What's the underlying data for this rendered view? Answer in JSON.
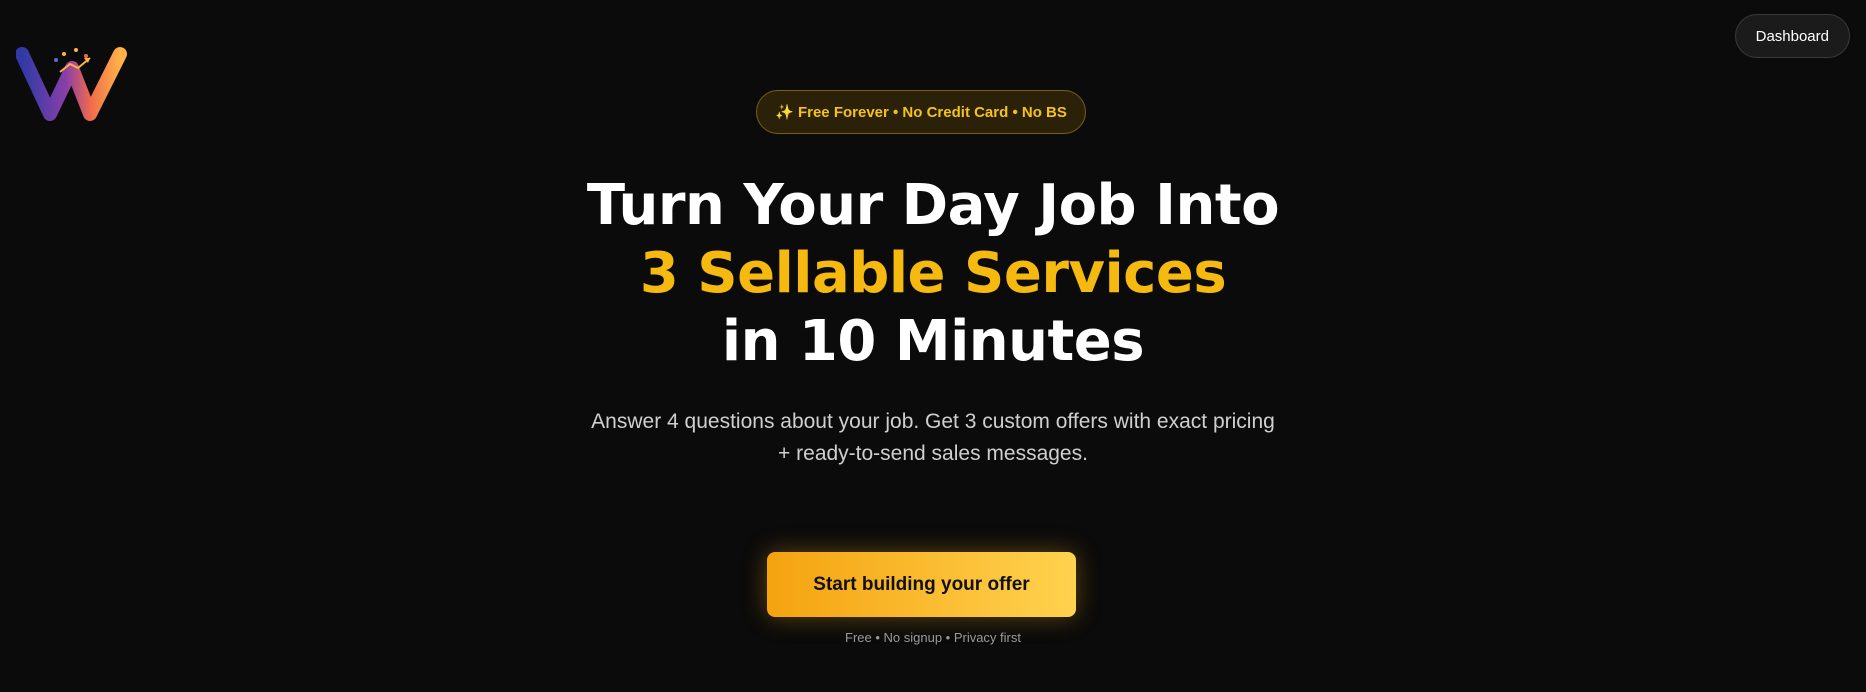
{
  "brand": {
    "logo_icon": "w-logo-with-growth-chart",
    "colors": {
      "background": "#0b0b0b",
      "accent": "#f5b90f",
      "logo_left": "#3a3fb0",
      "logo_right": "#ff8a3d"
    }
  },
  "header": {
    "dashboard_label": "Dashboard"
  },
  "hero": {
    "badge": "✨ Free Forever • No Credit Card • No BS",
    "headline_line1": "Turn Your Day Job Into",
    "headline_accent": "3 Sellable Services",
    "headline_line3": "in 10 Minutes",
    "subtitle": "Answer 4 questions about your job. Get 3 custom offers with exact pricing + ready-to-send sales messages.",
    "cta_label": "Start building your offer",
    "cta_note": "Free • No signup • Privacy first"
  }
}
